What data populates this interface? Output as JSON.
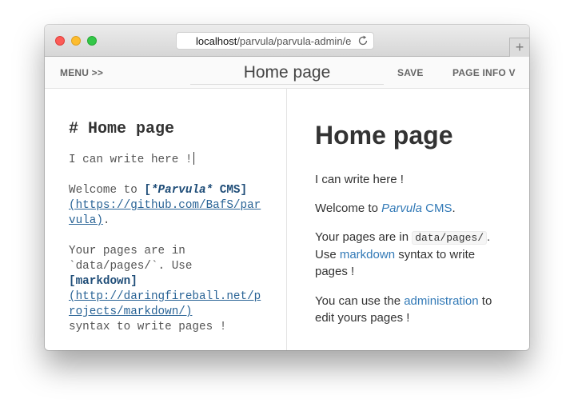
{
  "browser": {
    "url_host": "localhost",
    "url_path": "/parvula/parvula-admin/e"
  },
  "toolbar": {
    "menu_label": "MENU >>",
    "page_title": "Home page",
    "save_label": "SAVE",
    "page_info_label": "PAGE INFO V"
  },
  "editor": {
    "heading": "# Home page",
    "line1": "I can write here !",
    "line2_prefix": "Welcome to ",
    "line2_link_open": "[",
    "line2_link_em": "*Parvula*",
    "line2_link_rest": " CMS]",
    "line2_url": "(https://github.com/BafS/parvula)",
    "line2_suffix": ".",
    "line3_prefix": "Your pages are in",
    "line3_code": "`data/pages/`",
    "line3_mid": ". Use",
    "line3_link": "[markdown]",
    "line3_url": "(http://daringfireball.net/projects/markdown/)",
    "line3_suffix": "syntax to write pages !"
  },
  "preview": {
    "heading": "Home page",
    "p1": "I can write here !",
    "p2_prefix": "Welcome to ",
    "p2_link_em": "Parvula",
    "p2_link_rest": " CMS",
    "p2_suffix": ".",
    "p3_prefix": "Your pages are in ",
    "p3_code": "data/pages/",
    "p3_mid": ". Use ",
    "p3_link": "markdown",
    "p3_suffix": " syntax to write pages !",
    "p4_prefix": "You can use the ",
    "p4_link": "administration",
    "p4_suffix": " to edit yours pages !"
  }
}
